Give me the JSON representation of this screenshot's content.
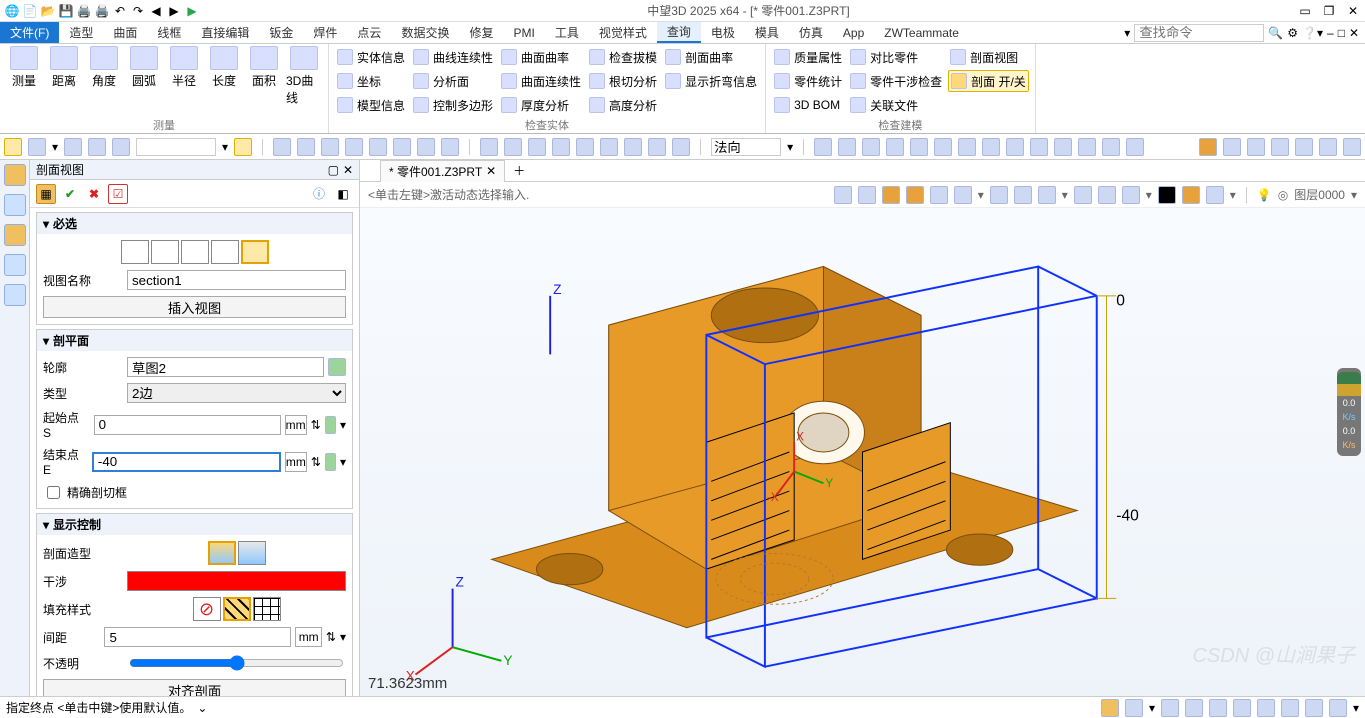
{
  "app": {
    "title": "中望3D 2025 x64 - [* 零件001.Z3PRT]"
  },
  "menubar": {
    "file": "文件(F)",
    "tabs": [
      "造型",
      "曲面",
      "线框",
      "直接编辑",
      "钣金",
      "焊件",
      "点云",
      "数据交换",
      "修复",
      "PMI",
      "工具",
      "视觉样式",
      "查询",
      "电极",
      "模具",
      "仿真",
      "App",
      "ZWTeammate"
    ],
    "active": 12,
    "search_placeholder": "查找命令"
  },
  "ribbon": {
    "measure": {
      "title": "测量",
      "items": [
        "测量",
        "距离",
        "角度",
        "圆弧",
        "半径",
        "长度",
        "面积",
        "3D曲线"
      ]
    },
    "entity": {
      "title": "检查实体",
      "cols": [
        [
          "实体信息",
          "坐标",
          "模型信息"
        ],
        [
          "曲线连续性",
          "分析面",
          "控制多边形"
        ],
        [
          "曲面曲率",
          "曲面连续性",
          "厚度分析"
        ],
        [
          "检查拔模",
          "根切分析",
          "高度分析"
        ],
        [
          "剖面曲率",
          "显示折弯信息"
        ]
      ]
    },
    "model": {
      "title": "检查建模",
      "cols": [
        [
          "质量属性",
          "零件统计",
          "3D BOM"
        ],
        [
          "对比零件",
          "零件干涉检查",
          "关联文件"
        ]
      ],
      "right": [
        "剖面视图",
        "剖面 开/关"
      ]
    }
  },
  "toolbar2": {
    "face_label": "法向"
  },
  "panel": {
    "title": "剖面视图",
    "required": "必选",
    "view_name_label": "视图名称",
    "view_name_value": "section1",
    "insert_view": "插入视图",
    "sec_plane": "剖平面",
    "profile_label": "轮廓",
    "profile_value": "草图2",
    "type_label": "类型",
    "type_value": "2边",
    "start_label": "起始点 S",
    "start_value": "0",
    "end_label": "结束点 E",
    "end_value": "-40",
    "unit": "mm",
    "precise_box": "精确剖切框",
    "display_ctrl": "显示控制",
    "section_shape": "剖面造型",
    "interference": "干涉",
    "fill_style": "填充样式",
    "spacing_label": "间距",
    "spacing_value": "5",
    "opacity_label": "不透明",
    "align_section": "对齐剖面"
  },
  "doc": {
    "tab": "* 零件001.Z3PRT",
    "hint": "<单击左键>激活动态选择输入.",
    "layer": "图层0000"
  },
  "viewport": {
    "dim1": "0",
    "dim2": "-40",
    "measure": "71.3623mm"
  },
  "status": {
    "left": "指定终点  <单击中键>使用默认值。",
    "watermark": "CSDN @山涧果子"
  }
}
